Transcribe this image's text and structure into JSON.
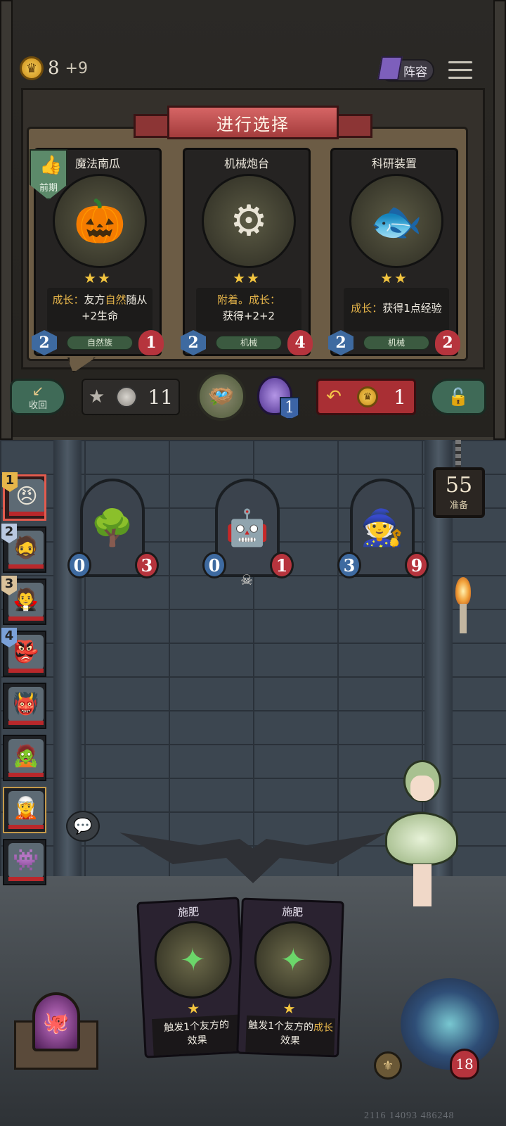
{
  "hud": {
    "gold_amount": "8",
    "gold_income": "+9",
    "lineup_label": "阵容"
  },
  "shop": {
    "title": "进行选择",
    "early_tag": "前期",
    "cards": [
      {
        "name": "魔法南瓜",
        "stars": "★★",
        "desc_prefix": "成长：",
        "desc_mid": "友方",
        "desc_hl": "自然",
        "desc_suffix": "随从",
        "desc_line2": "+2生命",
        "tribe": "自然族",
        "attack": "2",
        "health": "1"
      },
      {
        "name": "机械炮台",
        "stars": "★★",
        "desc_prefix": "附着。成长：",
        "desc_line2": "获得+2+2",
        "tribe": "机械",
        "attack": "2",
        "health": "4"
      },
      {
        "name": "科研装置",
        "stars": "★★",
        "desc_prefix": "成长：",
        "desc_mid": "获得1点经验",
        "tribe": "机械",
        "attack": "2",
        "health": "2"
      }
    ]
  },
  "actions": {
    "recall_label": "收回",
    "upgrade_cost": "11",
    "potion_count": "1",
    "refresh_cost": "1"
  },
  "board": {
    "prep_timer": "55",
    "prep_label": "准备",
    "minions": [
      {
        "attack": "0",
        "health": "3"
      },
      {
        "attack": "0",
        "health": "1"
      },
      {
        "attack": "3",
        "health": "9"
      }
    ]
  },
  "party": {
    "ranks": [
      "1",
      "2",
      "3",
      "4"
    ]
  },
  "hand": [
    {
      "name": "施肥",
      "star": "★",
      "desc_line1": "触发1个友方的",
      "desc_line2": "效果"
    },
    {
      "name": "施肥",
      "star": "★",
      "desc_line1a": "触发1个友方的",
      "desc_hl": "成长",
      "desc_line2": "效果"
    }
  ],
  "player": {
    "health": "18"
  },
  "footer": {
    "id_text": "2116 14093 486248"
  },
  "colors": {
    "accent_gold": "#e6b54a",
    "attack_blue": "#3e6aa0",
    "health_red": "#b6343d",
    "tribe_green": "#3b5a40",
    "refresh_red": "#a92f34"
  }
}
